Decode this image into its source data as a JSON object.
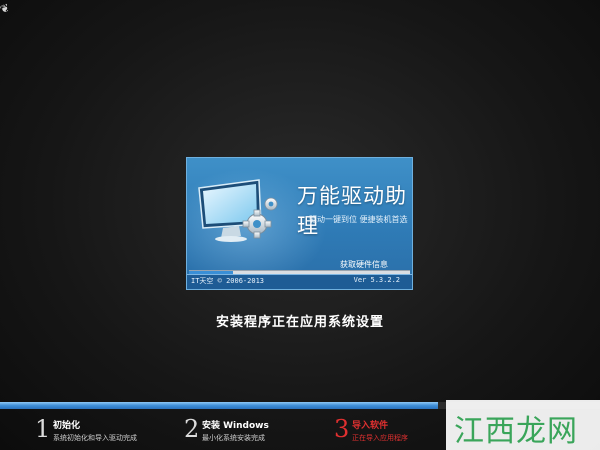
{
  "splash": {
    "title": "万能驱动助理",
    "subtitle": "驱动一键到位 便捷装机首选",
    "status": "获取硬件信息",
    "progress": 0.2,
    "copyright": "IT天空 © 2006-2013",
    "version": "Ver 5.3.2.2"
  },
  "main": {
    "status": "安装程序正在应用系统设置",
    "progress": 0.73
  },
  "steps": [
    {
      "num": "1",
      "title": "初始化",
      "desc": "系统初始化和导入驱动完成"
    },
    {
      "num": "2",
      "title": "安装 Windows",
      "desc": "最小化系统安装完成"
    },
    {
      "num": "3",
      "title": "导入软件",
      "desc": "正在导入应用程序"
    }
  ],
  "watermark": "江西龙网",
  "colors": {
    "accent": "#3f8fd8",
    "active_step": "#e03030",
    "splash_bg": "#3f90c8",
    "watermark": "#3aa55a"
  }
}
